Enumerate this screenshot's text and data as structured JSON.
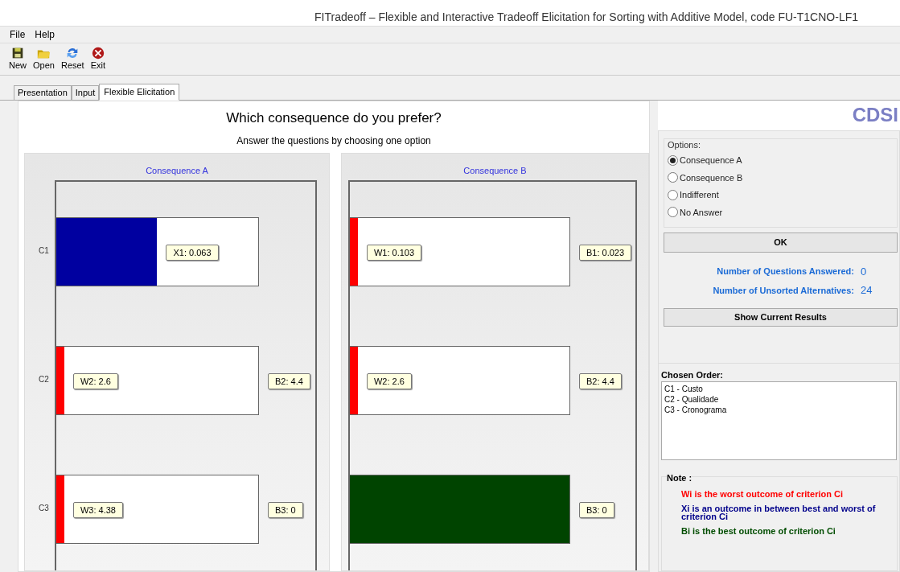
{
  "window": {
    "title": "FITradeoff – Flexible and Interactive Tradeoff Elicitation for Sorting with Additive Model, code FU-T1CNO-LF1"
  },
  "menu": [
    "File",
    "Help"
  ],
  "toolbar": [
    {
      "label": "New"
    },
    {
      "label": "Open"
    },
    {
      "label": "Reset"
    },
    {
      "label": "Exit"
    }
  ],
  "tabs": [
    {
      "label": "Presentation",
      "selected": false
    },
    {
      "label": "Input",
      "selected": false
    },
    {
      "label": "Flexible Elicitation",
      "selected": true
    }
  ],
  "question": {
    "title": "Which consequence do you prefer?",
    "subtitle": "Answer the questions by choosing one option"
  },
  "consequences": [
    {
      "title": "Consequence A",
      "rows": [
        {
          "criterion": "C1",
          "kind": "between",
          "level": 0.5,
          "bar_label": "X1: 0.063"
        },
        {
          "criterion": "C2",
          "kind": "worst",
          "level": 0.04,
          "bar_label": "W2: 2.6",
          "best_label": "B2: 4.4"
        },
        {
          "criterion": "C3",
          "kind": "worst",
          "level": 0.04,
          "bar_label": "W3: 4.38",
          "best_label": "B3: 0"
        }
      ]
    },
    {
      "title": "Consequence B",
      "rows": [
        {
          "kind": "worst",
          "level": 0.036,
          "bar_label": "W1: 0.103",
          "best_label": "B1: 0.023"
        },
        {
          "kind": "worst",
          "level": 0.036,
          "bar_label": "W2: 2.6",
          "best_label": "B2: 4.4"
        },
        {
          "kind": "best",
          "level": 1,
          "best_label": "B3: 0"
        }
      ]
    }
  ],
  "logo": "CDSI",
  "options": {
    "title": "Options:",
    "items": [
      {
        "label": "Consequence A",
        "selected": true
      },
      {
        "label": "Consequence B",
        "selected": false
      },
      {
        "label": "Indifferent",
        "selected": false
      },
      {
        "label": "No Answer",
        "selected": false
      }
    ]
  },
  "ok_button": "OK",
  "stats": [
    {
      "label": "Number of Questions Answered:",
      "value": "0"
    },
    {
      "label": "Number of Unsorted Alternatives:",
      "value": "24"
    }
  ],
  "results_button": "Show Current Results",
  "chosen_order": {
    "title": "Chosen Order:",
    "items": [
      "C1 - Custo",
      "C2 - Qualidade",
      "C3 - Cronograma"
    ]
  },
  "note": {
    "title": "Note :",
    "lines": [
      {
        "text": "Wi is the worst outcome of criterion Ci",
        "color": "#ff0000"
      },
      {
        "text": "Xi is an outcome in between best and worst of criterion Ci",
        "color": "#00008b"
      },
      {
        "text": "Bi is the best outcome of criterion Ci",
        "color": "#004d00"
      }
    ]
  }
}
